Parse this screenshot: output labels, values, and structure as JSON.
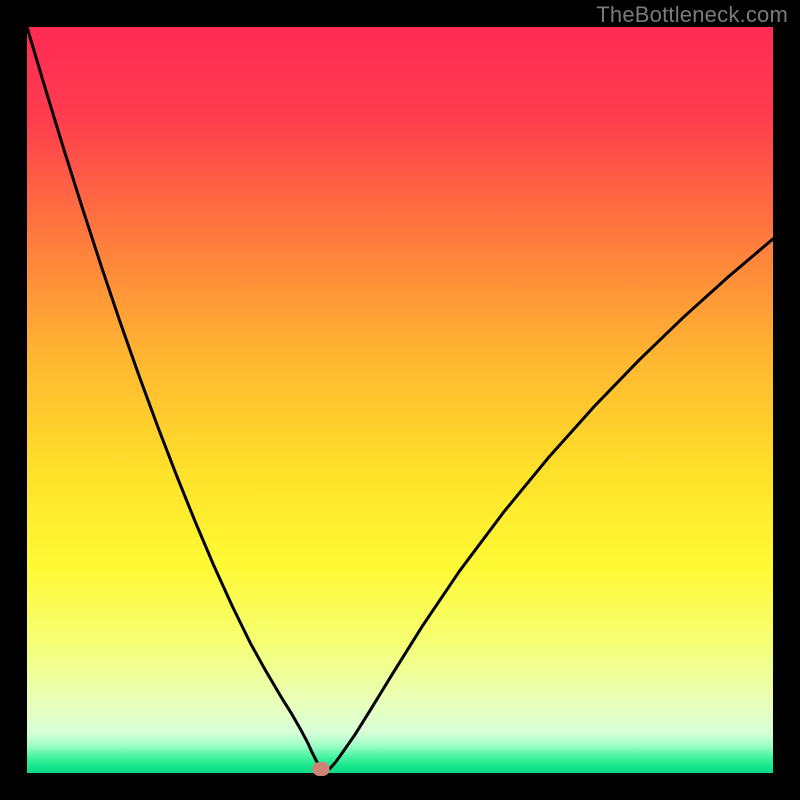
{
  "watermark": "TheBottleneck.com",
  "chart_data": {
    "type": "line",
    "title": "",
    "xlabel": "",
    "ylabel": "",
    "xlim": [
      0,
      1
    ],
    "ylim": [
      0,
      1
    ],
    "gradient_stops": [
      {
        "pos": 0.0,
        "color": "#ff2b54"
      },
      {
        "pos": 0.12,
        "color": "#ff3c4e"
      },
      {
        "pos": 0.28,
        "color": "#ff7a3e"
      },
      {
        "pos": 0.44,
        "color": "#ffb531"
      },
      {
        "pos": 0.6,
        "color": "#ffe22a"
      },
      {
        "pos": 0.72,
        "color": "#fff934"
      },
      {
        "pos": 0.82,
        "color": "#f6ff70"
      },
      {
        "pos": 0.9,
        "color": "#eaffb5"
      },
      {
        "pos": 0.945,
        "color": "#d9ffd7"
      },
      {
        "pos": 0.963,
        "color": "#a0ffc8"
      },
      {
        "pos": 0.978,
        "color": "#48f3a0"
      },
      {
        "pos": 0.992,
        "color": "#12e58b"
      },
      {
        "pos": 1.0,
        "color": "#0fd884"
      }
    ],
    "series": [
      {
        "name": "curve",
        "x": [
          0.0,
          0.025,
          0.05,
          0.075,
          0.1,
          0.125,
          0.15,
          0.175,
          0.2,
          0.225,
          0.25,
          0.275,
          0.3,
          0.32,
          0.34,
          0.355,
          0.367,
          0.376,
          0.382,
          0.387,
          0.391,
          0.394,
          0.398,
          0.402,
          0.407,
          0.414,
          0.424,
          0.44,
          0.46,
          0.49,
          0.53,
          0.58,
          0.64,
          0.7,
          0.76,
          0.82,
          0.88,
          0.94,
          1.0
        ],
        "y": [
          1.0,
          0.916,
          0.834,
          0.755,
          0.678,
          0.604,
          0.533,
          0.465,
          0.4,
          0.338,
          0.279,
          0.224,
          0.173,
          0.137,
          0.103,
          0.079,
          0.058,
          0.041,
          0.028,
          0.018,
          0.011,
          0.006,
          0.003,
          0.003,
          0.007,
          0.015,
          0.029,
          0.052,
          0.084,
          0.133,
          0.197,
          0.271,
          0.351,
          0.424,
          0.491,
          0.553,
          0.611,
          0.665,
          0.716
        ]
      }
    ],
    "marker": {
      "x": 0.394,
      "y": 0.005,
      "color": "#cf8277"
    }
  }
}
